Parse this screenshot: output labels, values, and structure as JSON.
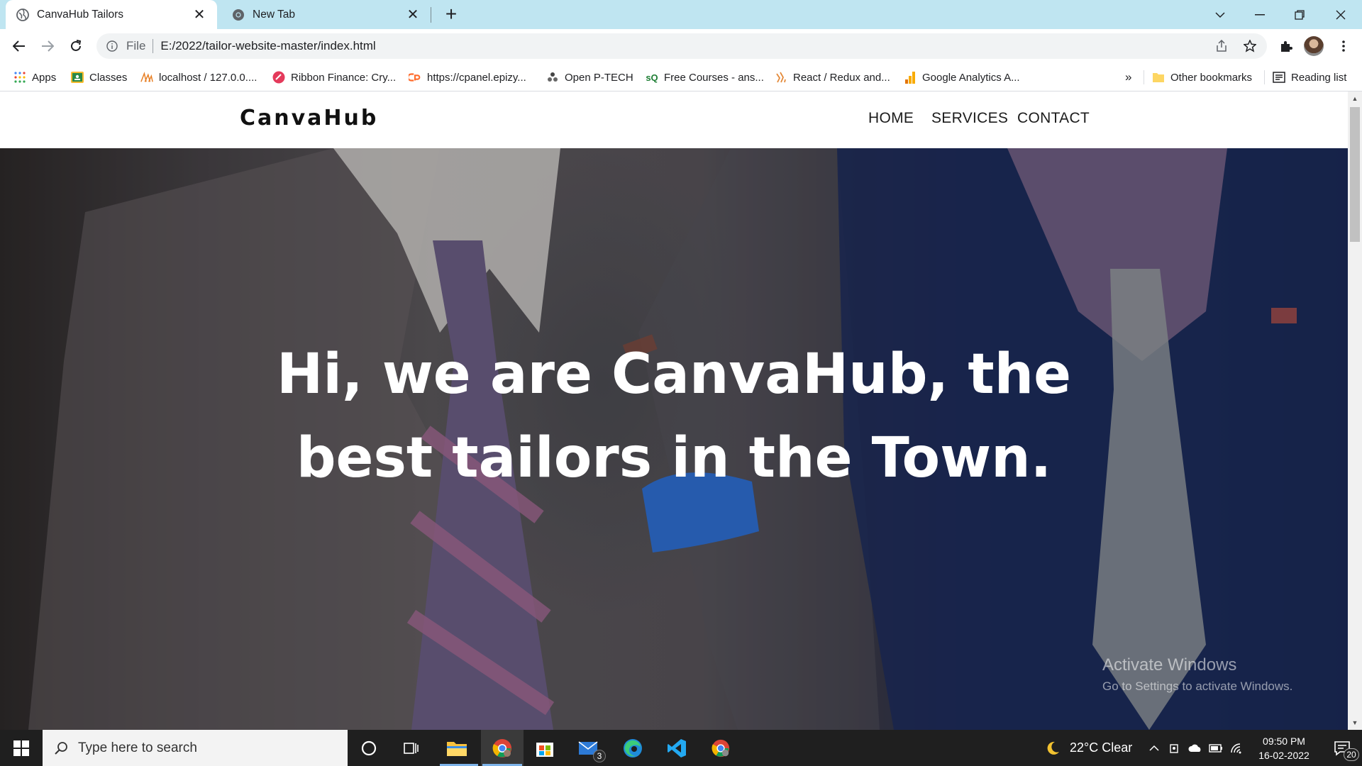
{
  "browser": {
    "tabs": [
      {
        "title": "CanvaHub Tailors",
        "active": true
      },
      {
        "title": "New Tab",
        "active": false
      }
    ],
    "address": {
      "scheme": "File",
      "url": "E:/2022/tailor-website-master/index.html"
    },
    "bookmarks": [
      {
        "label": "Apps",
        "icon": "apps-grid-icon"
      },
      {
        "label": "Classes",
        "icon": "classroom-icon"
      },
      {
        "label": "localhost / 127.0.0....",
        "icon": "phpmyadmin-icon"
      },
      {
        "label": "Ribbon Finance: Cry...",
        "icon": "ribbon-icon"
      },
      {
        "label": "https://cpanel.epizy...",
        "icon": "cpanel-icon"
      },
      {
        "label": "Open P-TECH",
        "icon": "ptech-icon"
      },
      {
        "label": "Free Courses - ans...",
        "icon": "courses-icon"
      },
      {
        "label": "React / Redux and...",
        "icon": "redux-icon"
      },
      {
        "label": "Google Analytics A...",
        "icon": "analytics-icon"
      }
    ],
    "bookmarks_overflow": "»",
    "other_bookmarks": "Other bookmarks",
    "reading_list": "Reading list"
  },
  "site": {
    "logo": "CanvaHub",
    "nav": [
      "HOME",
      "SERVICES",
      "CONTACT"
    ],
    "hero_line1": "Hi, we are CanvaHub, the",
    "hero_line2": "best tailors in the Town."
  },
  "watermark": {
    "title": "Activate Windows",
    "subtitle": "Go to Settings to activate Windows."
  },
  "taskbar": {
    "search_placeholder": "Type here to search",
    "mail_badge": "3",
    "weather": "22°C  Clear",
    "time": "09:50 PM",
    "date": "16-02-2022",
    "notifications": "20"
  },
  "colors": {
    "tabstrip": "#bfe5f1",
    "taskbar": "#1f1f1f",
    "hero_text": "#ffffff"
  }
}
